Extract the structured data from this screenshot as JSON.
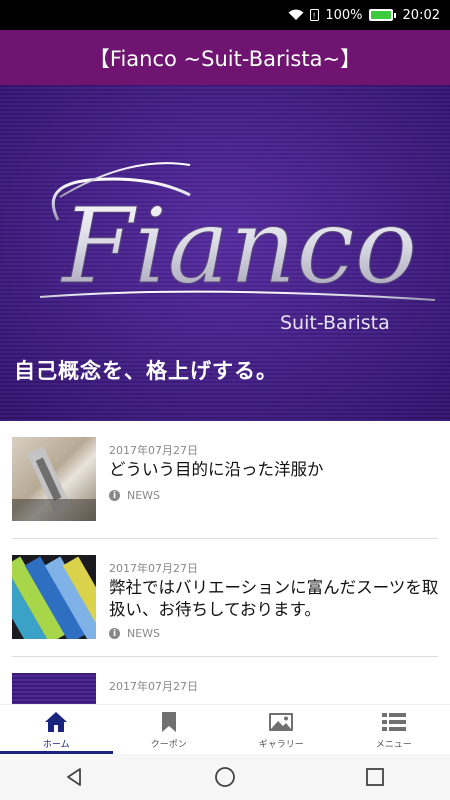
{
  "status_bar": {
    "battery": "100%",
    "time": "20:02"
  },
  "app_bar": {
    "title": "【Fianco ~Suit-Barista~】"
  },
  "hero": {
    "logo_text": "Fianco",
    "logo_sub": "Suit-Barista",
    "tagline": "自己概念を、格上げする。"
  },
  "news": [
    {
      "date": "2017年07月27日",
      "title": "どういう目的に沿った洋服か",
      "category": "NEWS"
    },
    {
      "date": "2017年07月27日",
      "title": "弊社ではバリエーションに富んだスーツを取扱い、お待ちしております。",
      "category": "NEWS"
    },
    {
      "date": "2017年07月27日",
      "title": "",
      "category": ""
    }
  ],
  "bottom_nav": {
    "items": [
      {
        "label": "ホーム",
        "icon": "home-icon",
        "active": true
      },
      {
        "label": "クーポン",
        "icon": "bookmark-icon",
        "active": false
      },
      {
        "label": "ギャラリー",
        "icon": "image-icon",
        "active": false
      },
      {
        "label": "メニュー",
        "icon": "menu-list-icon",
        "active": false
      }
    ]
  },
  "colors": {
    "app_bar": "#6f1470",
    "hero": "#3d1a7a",
    "accent": "#1a237e"
  }
}
